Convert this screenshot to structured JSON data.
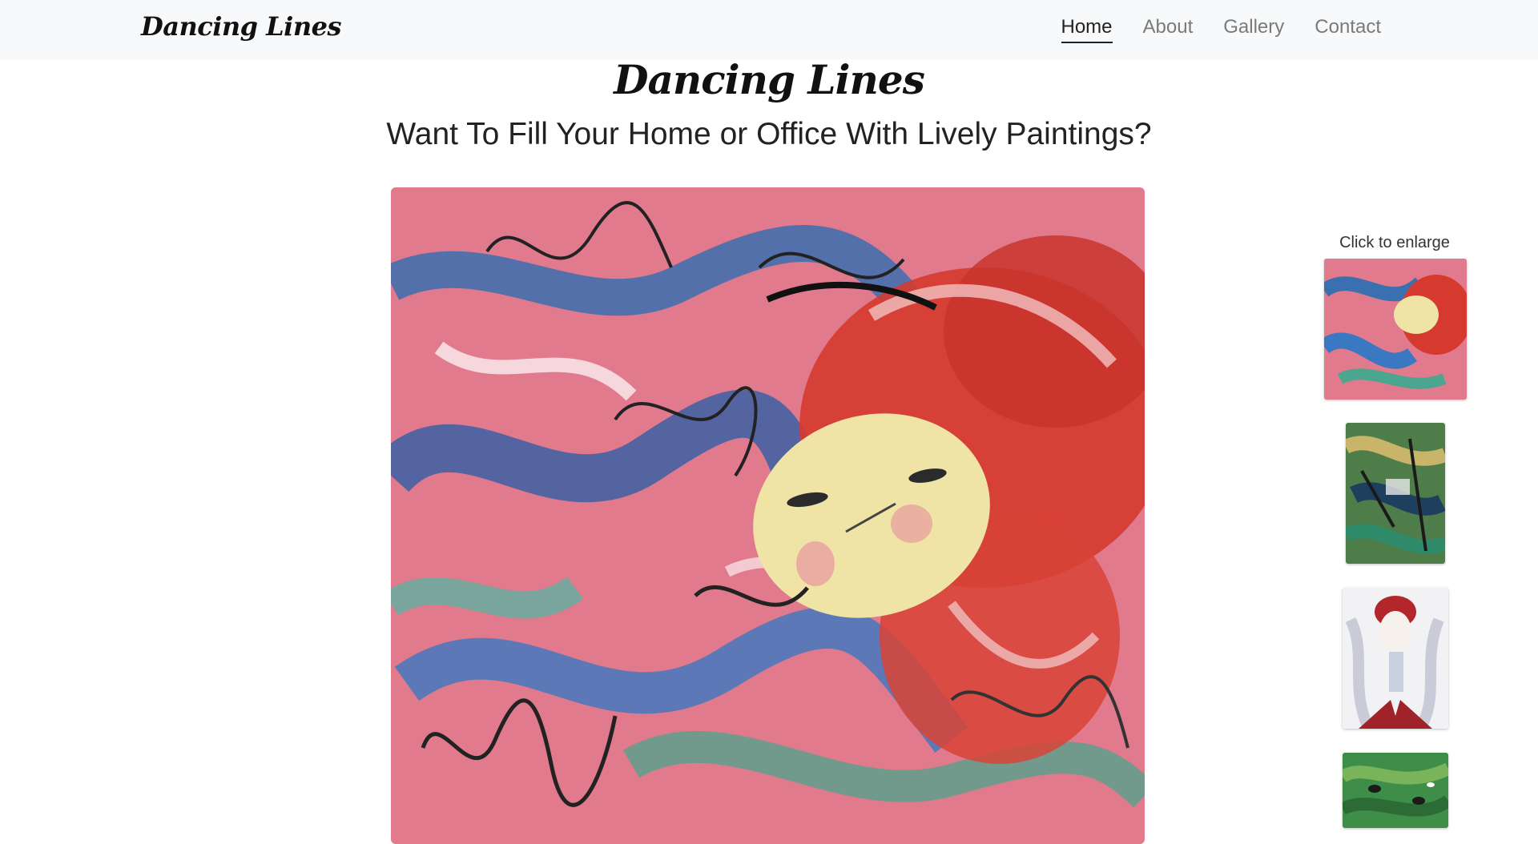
{
  "navbar": {
    "brand": "Dancing Lines",
    "links": [
      {
        "label": "Home",
        "active": true
      },
      {
        "label": "About",
        "active": false
      },
      {
        "label": "Gallery",
        "active": false
      },
      {
        "label": "Contact",
        "active": false
      }
    ]
  },
  "hero": {
    "title": "Dancing Lines",
    "subtitle": "Want To Fill Your Home or Office With Lively Paintings?"
  },
  "gallery": {
    "caption": "Click to enlarge",
    "thumbnail_count": 4
  },
  "colors": {
    "navbar_bg": "#f8f9fa",
    "painting_pink": "#e07a8c",
    "painting_red": "#d63a2e",
    "painting_blue": "#3a6fb0",
    "painting_face": "#efe4a6"
  }
}
